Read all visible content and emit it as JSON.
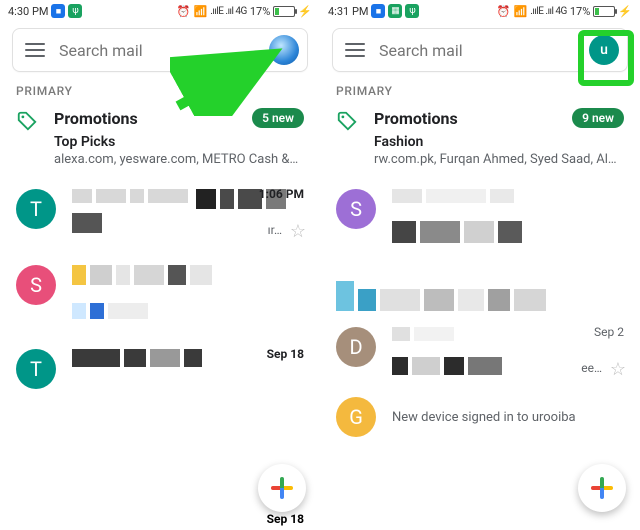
{
  "left": {
    "status": {
      "time": "4:30 PM",
      "net": ".ıılE  .ııl 4G",
      "battery": "17%"
    },
    "search_placeholder": "Search mail",
    "section": "PRIMARY",
    "promotions": {
      "title": "Promotions",
      "badge": "5 new",
      "subtitle": "Top Picks",
      "senders": "alexa.com, yesware.com, METRO Cash &…"
    },
    "conv1": {
      "letter": "T",
      "color": "#009688",
      "time": "1:06 PM",
      "snip": "ır…"
    },
    "conv2": {
      "letter": "S",
      "color": "#e84f7a"
    },
    "conv3": {
      "letter": "T",
      "color": "#009688",
      "time": "Sep 18"
    },
    "footer_time": "Sep 18"
  },
  "right": {
    "status": {
      "time": "4:31 PM",
      "net": ".ıılE  .ııl 4G",
      "battery": "17%"
    },
    "search_placeholder": "Search mail",
    "avatar_letter": "u",
    "section": "PRIMARY",
    "promotions": {
      "title": "Promotions",
      "badge": "9 new",
      "subtitle": "Fashion",
      "senders": "rw.com.pk, Furqan Ahmed, Syed Saad, Al…"
    },
    "conv1": {
      "letter": "S",
      "color": "#9d6fd6"
    },
    "conv2": {
      "letter": "D",
      "color": "#a68f7b",
      "time": "Sep 2",
      "snip": "ee…"
    },
    "conv3": {
      "letter": "G",
      "color": "#f4b93e",
      "footer": "New device signed in to urooiba"
    }
  }
}
